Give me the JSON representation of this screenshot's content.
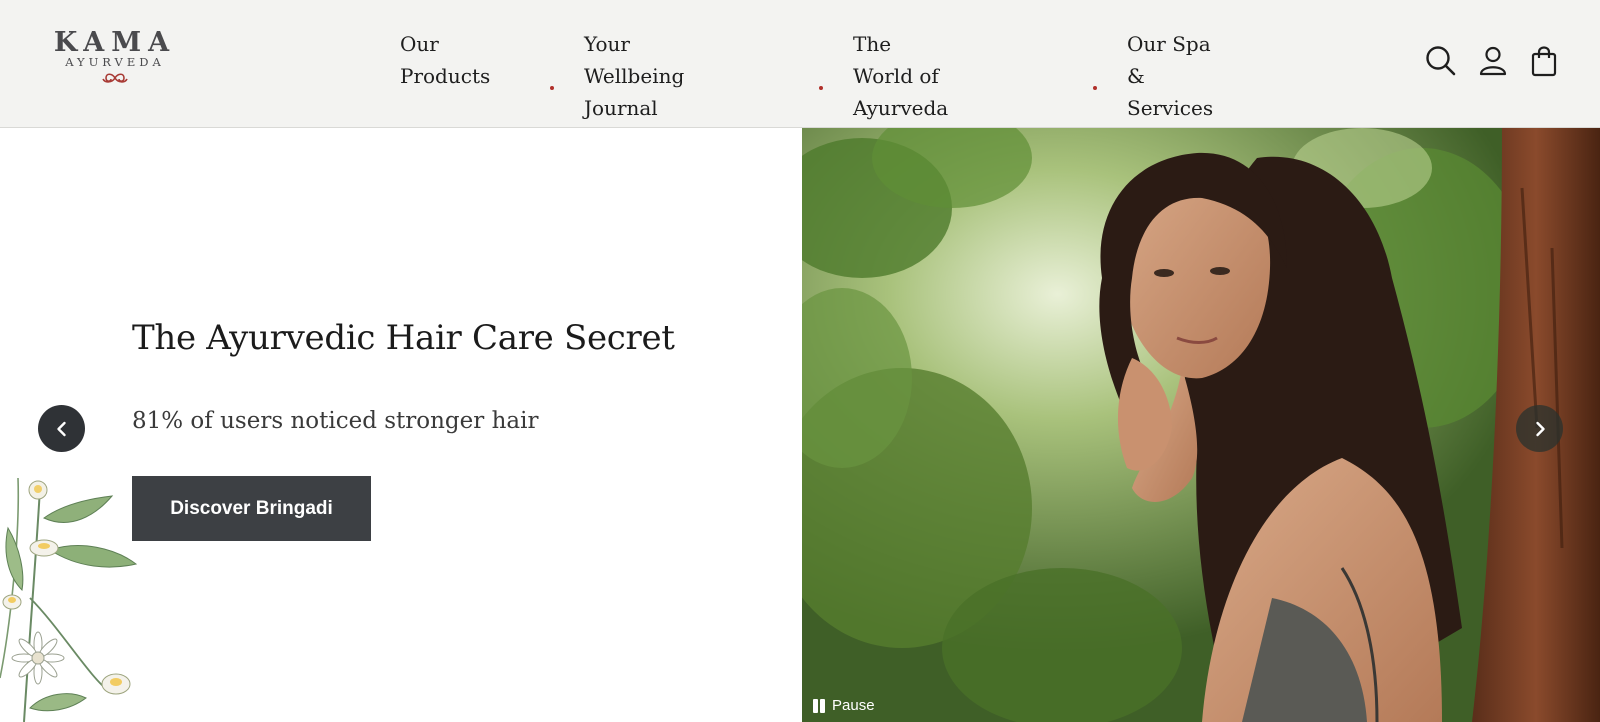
{
  "brand": {
    "name": "KAMA",
    "tagline": "AYURVEDA",
    "logo_icon": "kama-emblem-icon",
    "accent_color": "#b0302a"
  },
  "nav": {
    "items": [
      {
        "line1": "Our",
        "line2": "Products"
      },
      {
        "line1": "Your Wellbeing",
        "line2": "Journal"
      },
      {
        "line1": "The World of",
        "line2": "Ayurveda"
      },
      {
        "line1": "Our Spa &",
        "line2": "Services"
      }
    ]
  },
  "header_icons": [
    "search-icon",
    "account-icon",
    "shopping-bag-icon"
  ],
  "hero": {
    "title": "The Ayurvedic Hair Care Secret",
    "subtitle": "81% of  users noticed stronger hair",
    "cta_label": "Discover Bringadi",
    "cta_color": "#3d4044",
    "pause_label": "Pause",
    "prev_icon": "chevron-left-icon",
    "next_icon": "chevron-right-icon"
  }
}
